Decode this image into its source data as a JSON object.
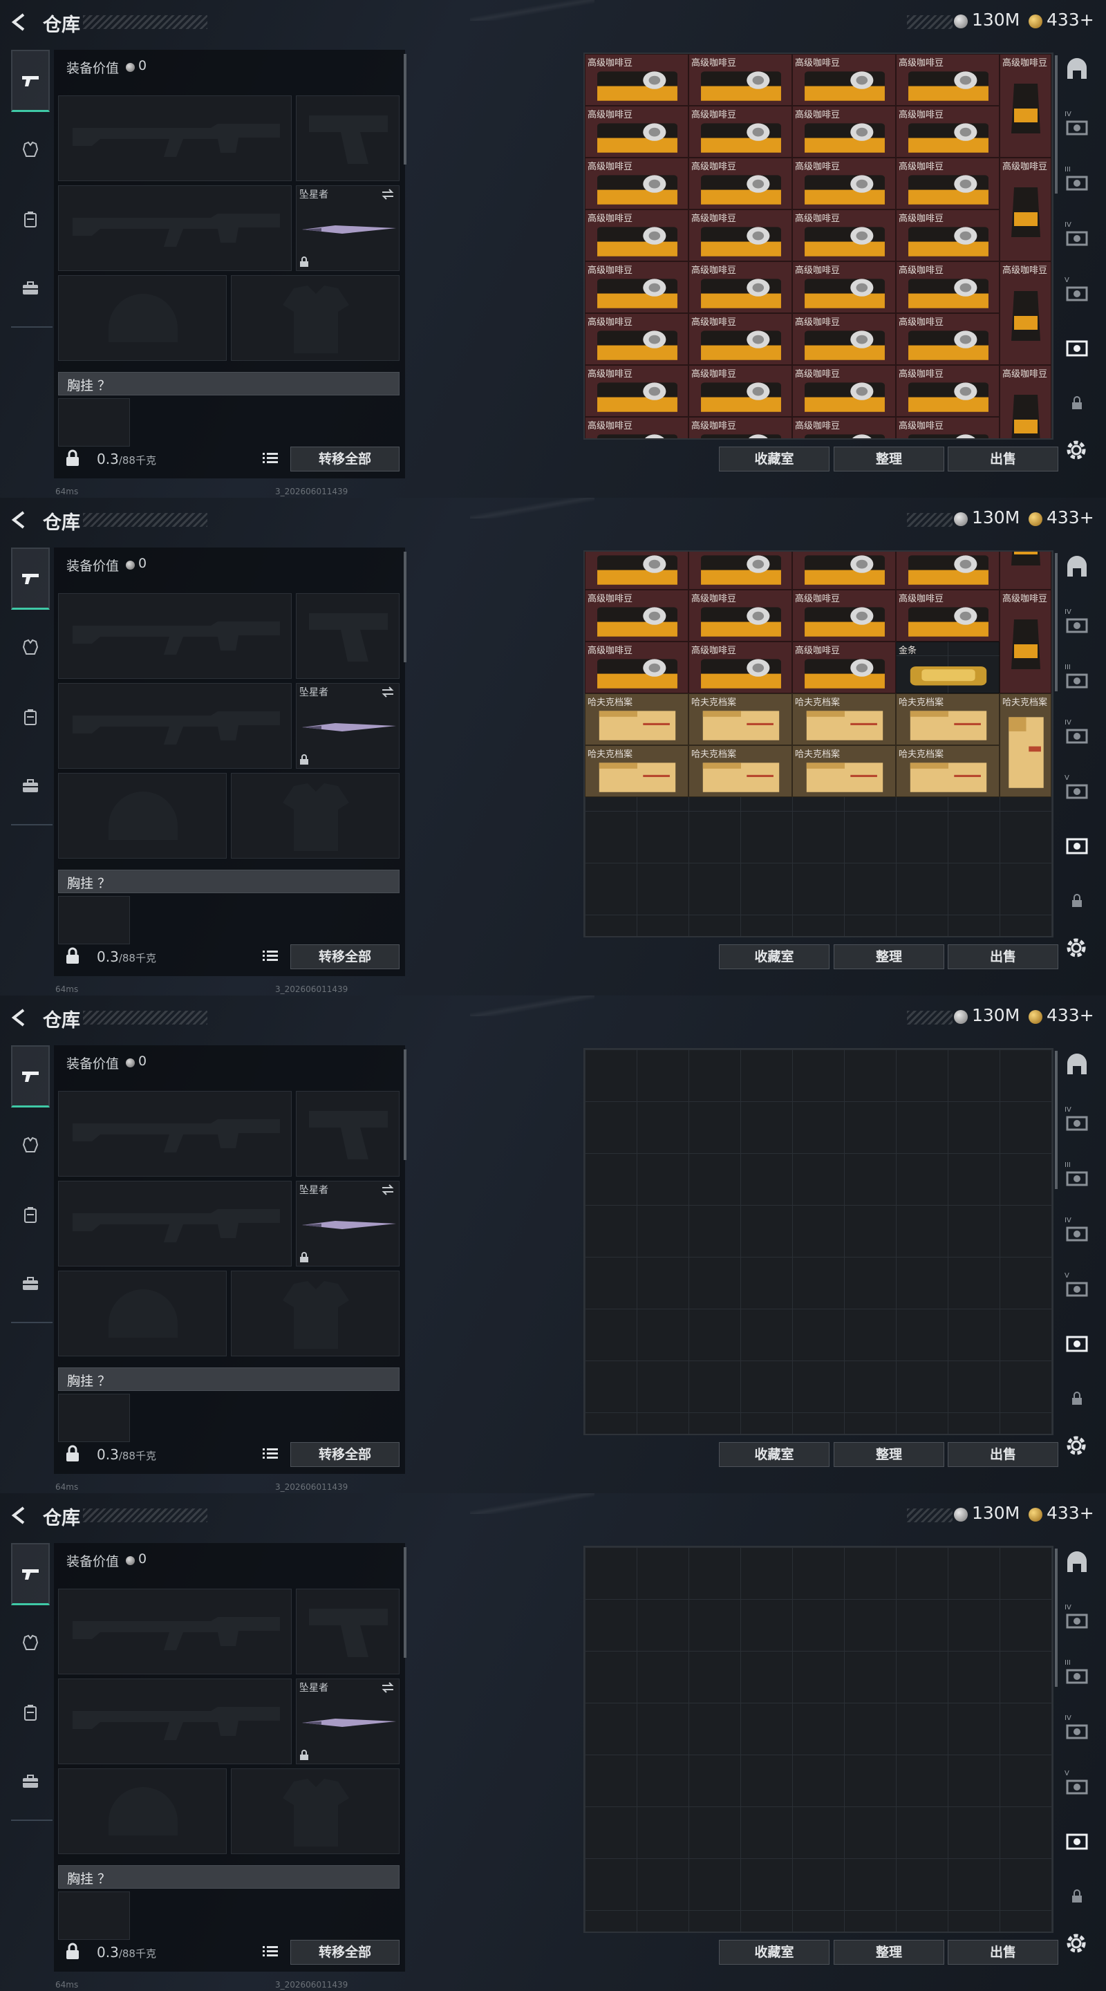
{
  "header": {
    "title": "仓库",
    "silver": "130M",
    "gold": "433+"
  },
  "loadout": {
    "value_label": "装备价值",
    "value": "0",
    "melee_name": "坠星者",
    "chest_label": "胸挂 ？",
    "weight": "0.3",
    "weight_max": "/88千克",
    "transfer_all": "转移全部"
  },
  "stash": {
    "collection_label": "收藏室",
    "sort_label": "整理",
    "sell_label": "出售",
    "coffee_label": "高级咖啡豆",
    "gold_label": "金条",
    "file_label": "哈夫克档案"
  },
  "status": {
    "ping": "64ms",
    "version": "3_202606011439"
  },
  "right_nav": [
    "IV",
    "III",
    "IV",
    "V"
  ]
}
